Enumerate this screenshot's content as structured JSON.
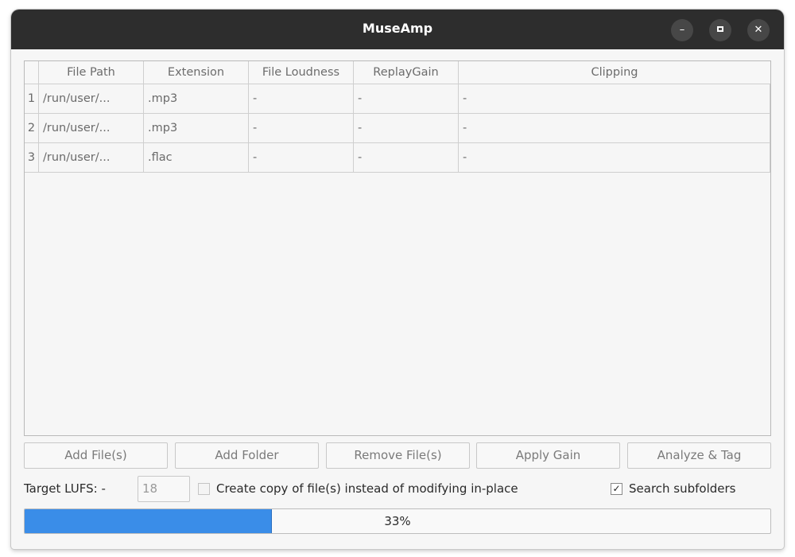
{
  "window": {
    "title": "MuseAmp",
    "controls": {
      "minimize_icon": "minimize-icon",
      "maximize_icon": "maximize-icon",
      "close_icon": "close-icon"
    }
  },
  "table": {
    "columns": [
      "File Path",
      "Extension",
      "File Loudness",
      "ReplayGain",
      "Clipping"
    ],
    "rows": [
      {
        "num": "1",
        "path": "/run/user/...",
        "ext": ".mp3",
        "loudness": "-",
        "gain": "-",
        "clipping": "-"
      },
      {
        "num": "2",
        "path": "/run/user/...",
        "ext": ".mp3",
        "loudness": "-",
        "gain": "-",
        "clipping": "-"
      },
      {
        "num": "3",
        "path": "/run/user/...",
        "ext": ".flac",
        "loudness": "-",
        "gain": "-",
        "clipping": "-"
      }
    ]
  },
  "buttons": {
    "add_files": "Add File(s)",
    "add_folder": "Add Folder",
    "remove_files": "Remove File(s)",
    "apply_gain": "Apply Gain",
    "analyze_tag": "Analyze & Tag"
  },
  "options": {
    "target_lufs_label": "Target LUFS: -",
    "target_lufs_value": "18",
    "create_copy_label": "Create copy of file(s) instead of modifying in-place",
    "create_copy_checked": false,
    "search_subfolders_label": "Search subfolders",
    "search_subfolders_checked": true
  },
  "progress": {
    "value": 33,
    "label": "33%"
  },
  "colors": {
    "titlebar": "#2d2d2d",
    "accent": "#3a8de8"
  }
}
